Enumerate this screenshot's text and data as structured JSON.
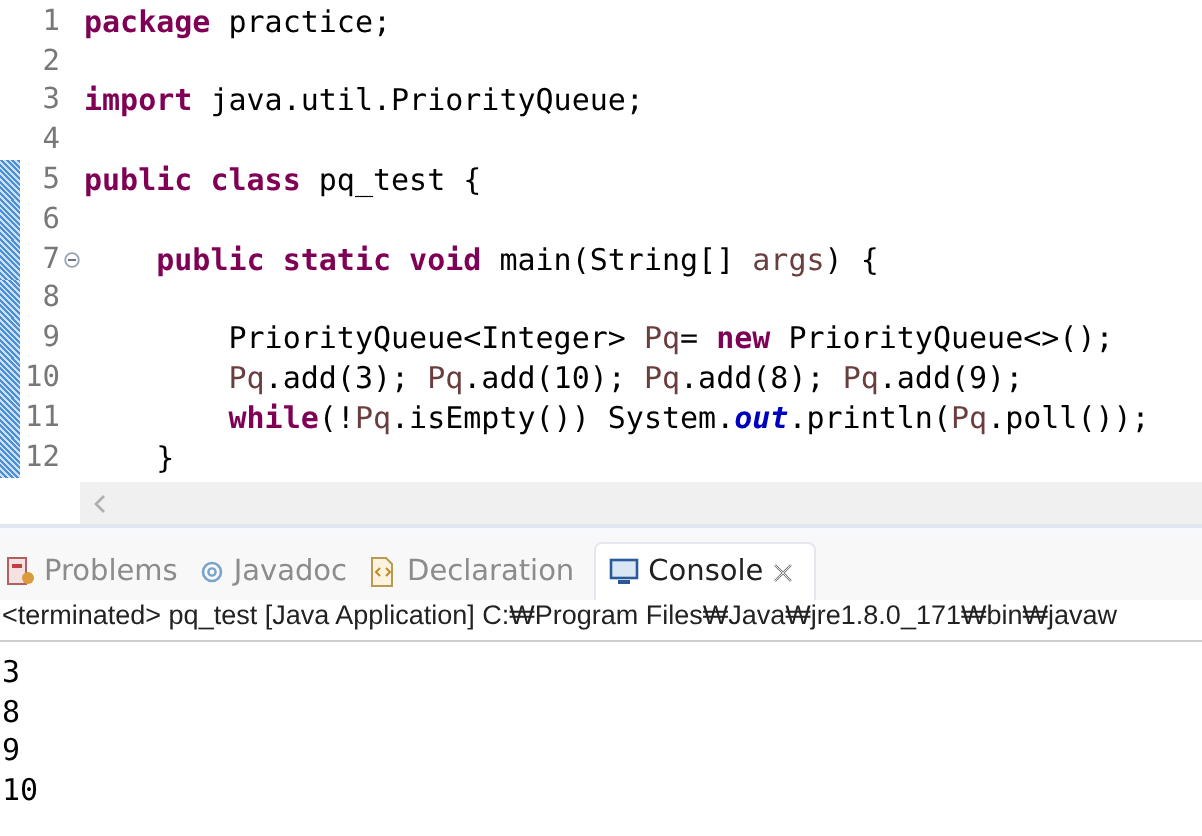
{
  "editor": {
    "lines": [
      {
        "number": "1",
        "changed": false,
        "foldable": false,
        "tokens": [
          {
            "kind": "keyword",
            "text": "package"
          },
          {
            "kind": "plain",
            "text": " practice;"
          }
        ]
      },
      {
        "number": "2",
        "changed": false,
        "foldable": false
      },
      {
        "number": "3",
        "changed": false,
        "foldable": false,
        "tokens": [
          {
            "kind": "keyword",
            "text": "import"
          },
          {
            "kind": "plain",
            "text": " java.util.PriorityQueue;"
          }
        ]
      },
      {
        "number": "4",
        "changed": false,
        "foldable": false
      },
      {
        "number": "5",
        "changed": true,
        "foldable": false,
        "tokens": [
          {
            "kind": "keyword",
            "text": "public"
          },
          {
            "kind": "keyword",
            "text": " class"
          },
          {
            "kind": "plain",
            "text": " pq_test {"
          }
        ]
      },
      {
        "number": "6",
        "changed": true,
        "foldable": false
      },
      {
        "number": "7",
        "changed": true,
        "foldable": true,
        "tokens": [
          {
            "kind": "keyword",
            "text": "    public"
          },
          {
            "kind": "keyword",
            "text": " static"
          },
          {
            "kind": "keyword",
            "text": " void"
          },
          {
            "kind": "plain",
            "text": " main(String[] "
          },
          {
            "kind": "variable",
            "text": "args"
          },
          {
            "kind": "plain",
            "text": ") {"
          }
        ]
      },
      {
        "number": "8",
        "changed": true,
        "foldable": false
      },
      {
        "number": "9",
        "changed": true,
        "foldable": false,
        "tokens": [
          {
            "kind": "plain",
            "text": "        PriorityQueue<Integer> "
          },
          {
            "kind": "variable",
            "text": "Pq"
          },
          {
            "kind": "plain",
            "text": "= "
          },
          {
            "kind": "keyword",
            "text": "new"
          },
          {
            "kind": "plain",
            "text": " PriorityQueue<>();"
          }
        ]
      },
      {
        "number": "10",
        "changed": true,
        "foldable": false,
        "tokens": [
          {
            "kind": "variable",
            "text": "        Pq"
          },
          {
            "kind": "plain",
            "text": ".add(3); "
          },
          {
            "kind": "variable",
            "text": "Pq"
          },
          {
            "kind": "plain",
            "text": ".add(10); "
          },
          {
            "kind": "variable",
            "text": "Pq"
          },
          {
            "kind": "plain",
            "text": ".add(8); "
          },
          {
            "kind": "variable",
            "text": "Pq"
          },
          {
            "kind": "plain",
            "text": ".add(9);"
          }
        ]
      },
      {
        "number": "11",
        "changed": true,
        "foldable": false,
        "tokens": [
          {
            "kind": "keyword",
            "text": "        while"
          },
          {
            "kind": "plain",
            "text": "(!"
          },
          {
            "kind": "variable",
            "text": "Pq"
          },
          {
            "kind": "plain",
            "text": ".isEmpty()) System."
          },
          {
            "kind": "static_field",
            "text": "out"
          },
          {
            "kind": "plain",
            "text": ".println("
          },
          {
            "kind": "variable",
            "text": "Pq"
          },
          {
            "kind": "plain",
            "text": ".poll());"
          }
        ]
      },
      {
        "number": "12",
        "changed": true,
        "foldable": false,
        "tokens": [
          {
            "kind": "plain",
            "text": "    }"
          }
        ]
      }
    ]
  },
  "tabs": [
    {
      "label": "Problems",
      "kind": "problems",
      "selected": false
    },
    {
      "label": "Javadoc",
      "kind": "javadoc",
      "selected": false
    },
    {
      "label": "Declaration",
      "kind": "declaration",
      "selected": false
    },
    {
      "label": "Console",
      "kind": "console",
      "selected": true
    }
  ],
  "console": {
    "header": "<terminated> pq_test [Java Application] C:₩Program Files₩Java₩jre1.8.0_171₩bin₩javaw",
    "output": [
      "3",
      "8",
      "9",
      "10"
    ]
  }
}
